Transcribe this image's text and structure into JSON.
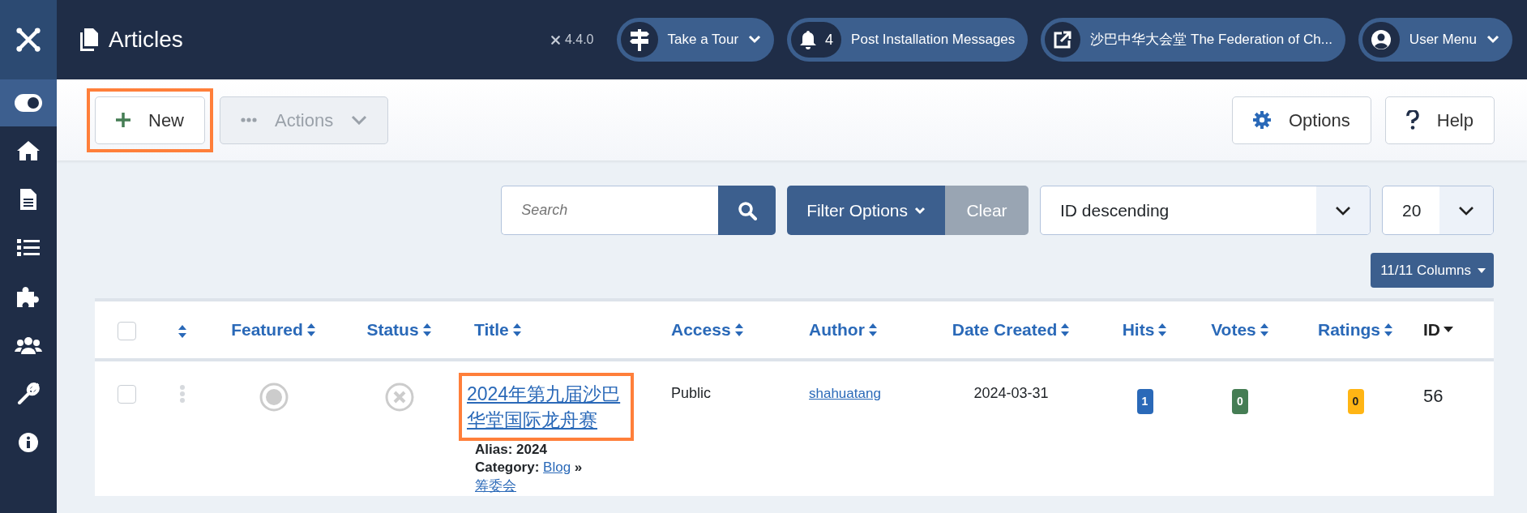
{
  "header": {
    "title": "Articles",
    "version": "4.4.0",
    "pills": [
      {
        "kind": "tour",
        "label": "Take a Tour"
      },
      {
        "kind": "messages",
        "count": "4",
        "label": "Post Installation Messages"
      },
      {
        "kind": "site",
        "label": "沙巴中华大会堂 The Federation of Ch..."
      },
      {
        "kind": "user",
        "label": "User Menu"
      }
    ]
  },
  "sidebar": {
    "items": [
      {
        "kind": "toggle",
        "selected": true
      },
      {
        "kind": "home",
        "selected": false
      },
      {
        "kind": "content",
        "selected": false
      },
      {
        "kind": "menus",
        "selected": false
      },
      {
        "kind": "extensions",
        "selected": false
      },
      {
        "kind": "users",
        "selected": false
      },
      {
        "kind": "system",
        "selected": false
      },
      {
        "kind": "help",
        "selected": false
      }
    ]
  },
  "toolbar": {
    "buttons": [
      {
        "kind": "new",
        "label": "New",
        "disabled": false,
        "highlighted": true
      },
      {
        "kind": "actions",
        "label": "Actions",
        "disabled": true,
        "highlighted": false
      },
      {
        "kind": "options",
        "label": "Options",
        "disabled": false,
        "highlighted": false
      },
      {
        "kind": "help",
        "label": "Help",
        "disabled": false,
        "highlighted": false
      }
    ]
  },
  "filters": {
    "search": {
      "placeholder": "Search"
    },
    "filter_options": "Filter Options",
    "clear": "Clear",
    "ordering": "ID descending",
    "limit": "20",
    "columns_button": "11/11 Columns"
  },
  "table": {
    "columns": [
      {
        "kind": "checkbox",
        "checked": false
      },
      {
        "kind": "ordering"
      },
      {
        "kind": "label",
        "label": "Featured",
        "sorted": false
      },
      {
        "kind": "label",
        "label": "Status",
        "sorted": false
      },
      {
        "kind": "label",
        "label": "Title",
        "sorted": false
      },
      {
        "kind": "label",
        "label": "Access",
        "sorted": false
      },
      {
        "kind": "label",
        "label": "Author",
        "sorted": false
      },
      {
        "kind": "label",
        "label": "Date Created",
        "sorted": false
      },
      {
        "kind": "label",
        "label": "Hits",
        "sorted": false
      },
      {
        "kind": "label",
        "label": "Votes",
        "sorted": false
      },
      {
        "kind": "label",
        "label": "Ratings",
        "sorted": false
      },
      {
        "kind": "label",
        "label": "ID",
        "sorted": true
      }
    ],
    "rows": [
      {
        "checked": false,
        "featured": false,
        "published": false,
        "title": "2024年第九届沙巴华堂国际龙舟赛",
        "title_highlighted": true,
        "alias": "Alias: 2024",
        "category_label": "Category:",
        "category": "Blog",
        "separator": "»",
        "subcategory": "筹委会",
        "access": "Public",
        "author": "shahuatang",
        "date_created": "2024-03-31",
        "hits": "1",
        "votes": "0",
        "ratings": "0",
        "id": "56"
      }
    ]
  }
}
